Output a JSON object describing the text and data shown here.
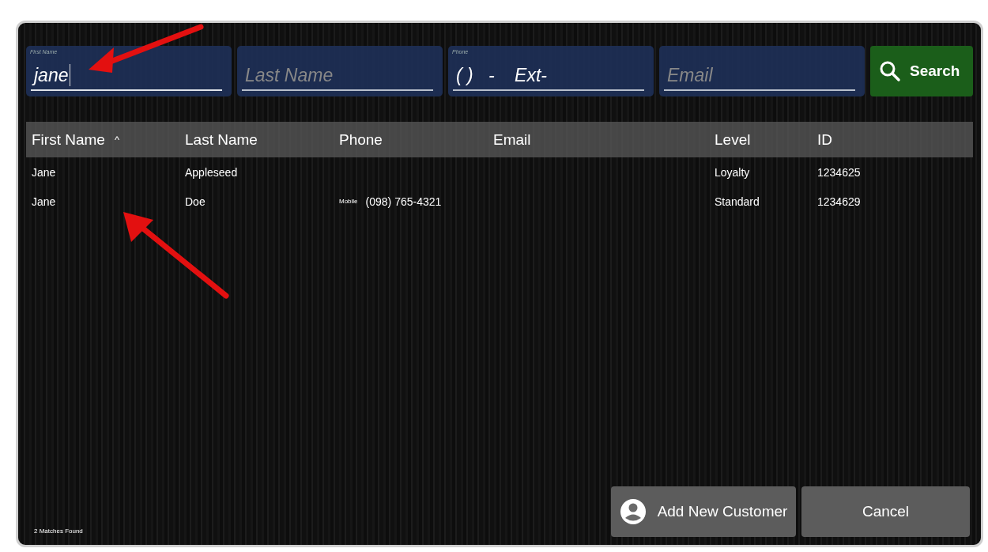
{
  "search_fields": [
    {
      "label": "First Name",
      "value": "jane",
      "focused": true
    },
    {
      "placeholder": "Last Name",
      "focused": false
    },
    {
      "label": "Phone",
      "value": "( )   -    Ext-",
      "focused": false
    },
    {
      "placeholder": "Email",
      "focused": false
    }
  ],
  "search_button": "Search",
  "table": {
    "columns": [
      {
        "label": "First Name",
        "sort_mark": "^"
      },
      {
        "label": "Last Name"
      },
      {
        "label": "Phone"
      },
      {
        "label": "Email"
      },
      {
        "label": "Level"
      },
      {
        "label": "ID"
      }
    ],
    "rows": [
      {
        "first_name": "Jane",
        "last_name": "Appleseed",
        "level": "Loyalty",
        "id": "1234625"
      },
      {
        "first_name": "Jane",
        "last_name": "Doe",
        "phone_type": "Mobile",
        "phone": "(098) 765-4321",
        "level": "Standard",
        "id": "1234629"
      }
    ]
  },
  "match_count": "2 Matches Found",
  "buttons": {
    "add": "Add New Customer",
    "cancel": "Cancel"
  }
}
